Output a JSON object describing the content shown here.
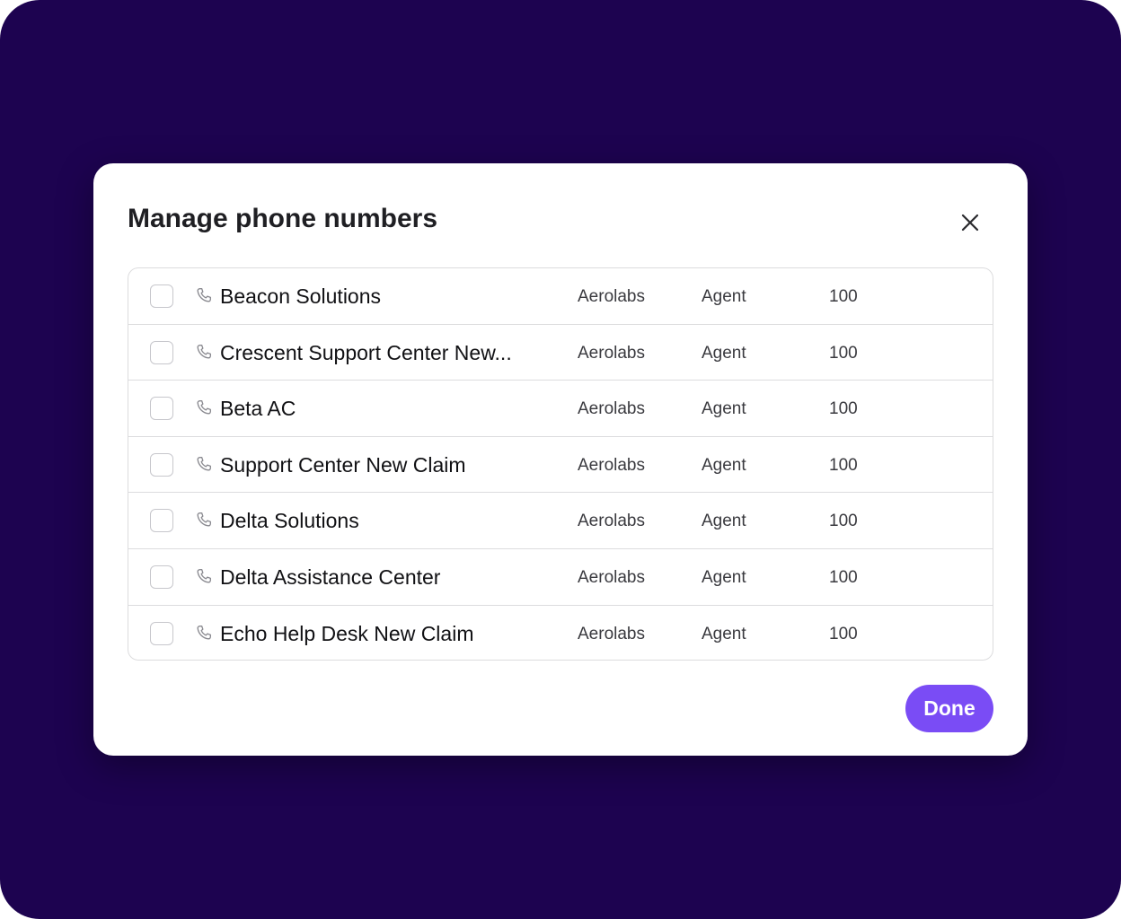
{
  "modal": {
    "title": "Manage phone numbers",
    "close_icon": "close-icon",
    "done_label": "Done"
  },
  "colors": {
    "backdrop": "#1d0350",
    "accent": "#7a4cf5"
  },
  "rows": [
    {
      "name": "Beacon Solutions",
      "org": "Aerolabs",
      "role": "Agent",
      "number": "100",
      "checked": false,
      "icon": "phone-icon"
    },
    {
      "name": "Crescent Support Center New...",
      "org": "Aerolabs",
      "role": "Agent",
      "number": "100",
      "checked": false,
      "icon": "phone-icon"
    },
    {
      "name": "Beta AC",
      "org": "Aerolabs",
      "role": "Agent",
      "number": "100",
      "checked": false,
      "icon": "phone-icon"
    },
    {
      "name": "Support Center New Claim",
      "org": "Aerolabs",
      "role": "Agent",
      "number": "100",
      "checked": false,
      "icon": "phone-icon"
    },
    {
      "name": "Delta Solutions",
      "org": "Aerolabs",
      "role": "Agent",
      "number": "100",
      "checked": false,
      "icon": "phone-icon"
    },
    {
      "name": "Delta Assistance Center",
      "org": "Aerolabs",
      "role": "Agent",
      "number": "100",
      "checked": false,
      "icon": "phone-icon"
    },
    {
      "name": "Echo Help Desk New Claim",
      "org": "Aerolabs",
      "role": "Agent",
      "number": "100",
      "checked": false,
      "icon": "phone-icon"
    }
  ]
}
